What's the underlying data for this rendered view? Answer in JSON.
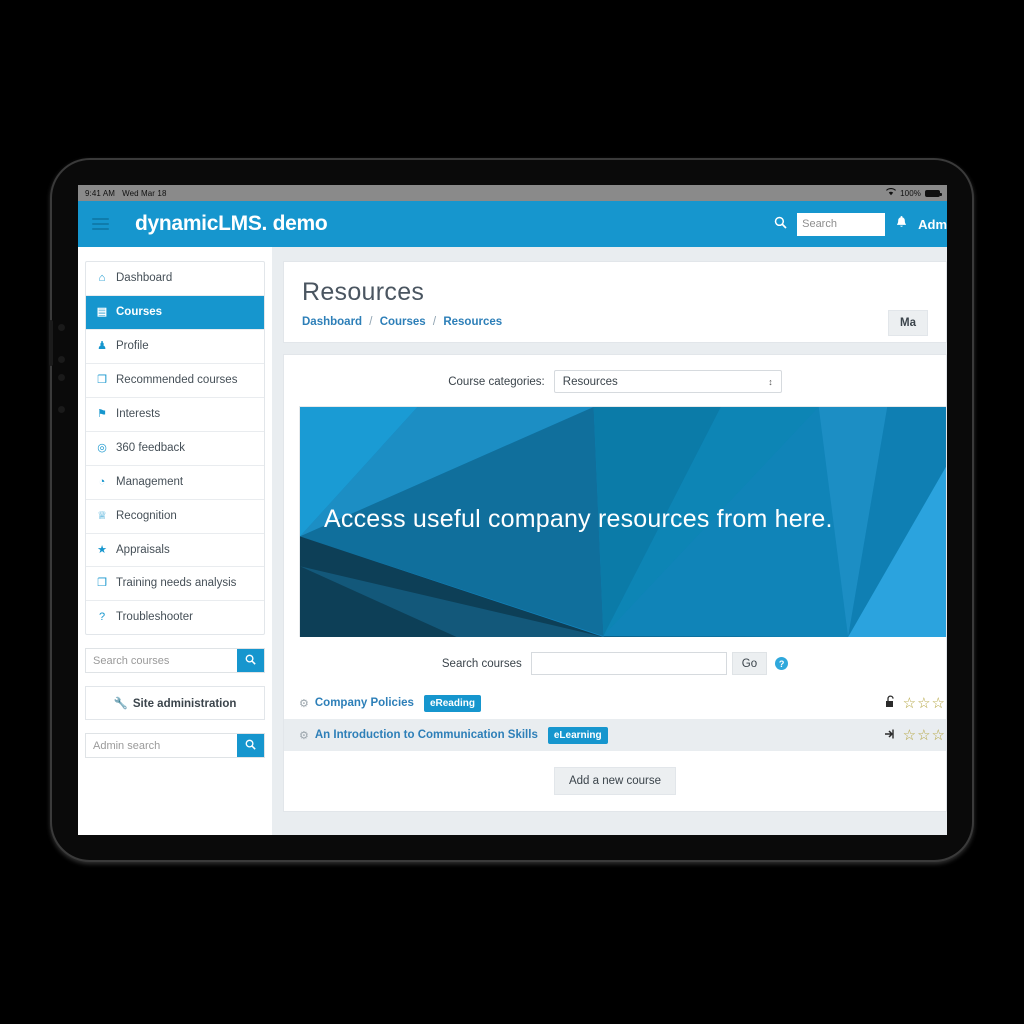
{
  "statusbar": {
    "time": "9:41 AM",
    "date": "Wed Mar 18",
    "battery": "100%",
    "wifi_icon": "wifi-icon"
  },
  "navbar": {
    "menu_icon": "hamburger-icon",
    "brand": "dynamicLMS. demo",
    "search_icon": "search-icon",
    "search_placeholder": "Search",
    "bell_icon": "bell-icon",
    "user_label": "Adm"
  },
  "sidebar": {
    "items": [
      {
        "label": "Dashboard",
        "icon": "home-icon",
        "glyph": "⌂",
        "active": false
      },
      {
        "label": "Courses",
        "icon": "book-icon",
        "glyph": "▤",
        "active": true
      },
      {
        "label": "Profile",
        "icon": "user-icon",
        "glyph": "♟",
        "active": false
      },
      {
        "label": "Recommended courses",
        "icon": "copy-icon",
        "glyph": "❐",
        "active": false
      },
      {
        "label": "Interests",
        "icon": "bookmark-icon",
        "glyph": "⚑",
        "active": false
      },
      {
        "label": "360 feedback",
        "icon": "target-icon",
        "glyph": "◎",
        "active": false
      },
      {
        "label": "Management",
        "icon": "pie-chart-icon",
        "glyph": "◔",
        "active": false
      },
      {
        "label": "Recognition",
        "icon": "trophy-icon",
        "glyph": "♕",
        "active": false
      },
      {
        "label": "Appraisals",
        "icon": "star-icon",
        "glyph": "★",
        "active": false
      },
      {
        "label": "Training needs analysis",
        "icon": "copy-icon",
        "glyph": "❐",
        "active": false
      },
      {
        "label": "Troubleshooter",
        "icon": "question-icon",
        "glyph": "?",
        "active": false
      }
    ],
    "course_search_placeholder": "Search courses",
    "course_search_icon": "search-icon",
    "site_admin_label": "Site administration",
    "site_admin_icon": "wrench-icon",
    "admin_search_placeholder": "Admin search",
    "admin_search_icon": "search-icon"
  },
  "main": {
    "title": "Resources",
    "breadcrumb": [
      "Dashboard",
      "Courses",
      "Resources"
    ],
    "breadcrumb_separator": "/",
    "manage_button": "Ma",
    "category_label": "Course categories:",
    "category_value": "Resources",
    "category_caret": "↕",
    "banner_text": "Access useful company resources from here.",
    "search_label": "Search courses",
    "search_value": "",
    "go_label": "Go",
    "help_icon": "help-icon",
    "help_glyph": "?",
    "courses": [
      {
        "name": "Company Policies",
        "badge": "eReading",
        "icon": "course-icon",
        "status_icon": "unlock-icon",
        "status_glyph": "🔓",
        "stars": "☆☆☆",
        "alt": false
      },
      {
        "name": "An Introduction to Communication Skills",
        "badge": "eLearning",
        "icon": "course-icon",
        "status_icon": "enrol-icon",
        "status_glyph": "⮕",
        "stars": "☆☆☆",
        "alt": true
      }
    ],
    "add_course_label": "Add a new course"
  },
  "colors": {
    "brand_blue": "#1696ce",
    "link_blue": "#2d7fb8",
    "page_bg": "#e9edf0",
    "badge_blue": "#1696ce"
  }
}
